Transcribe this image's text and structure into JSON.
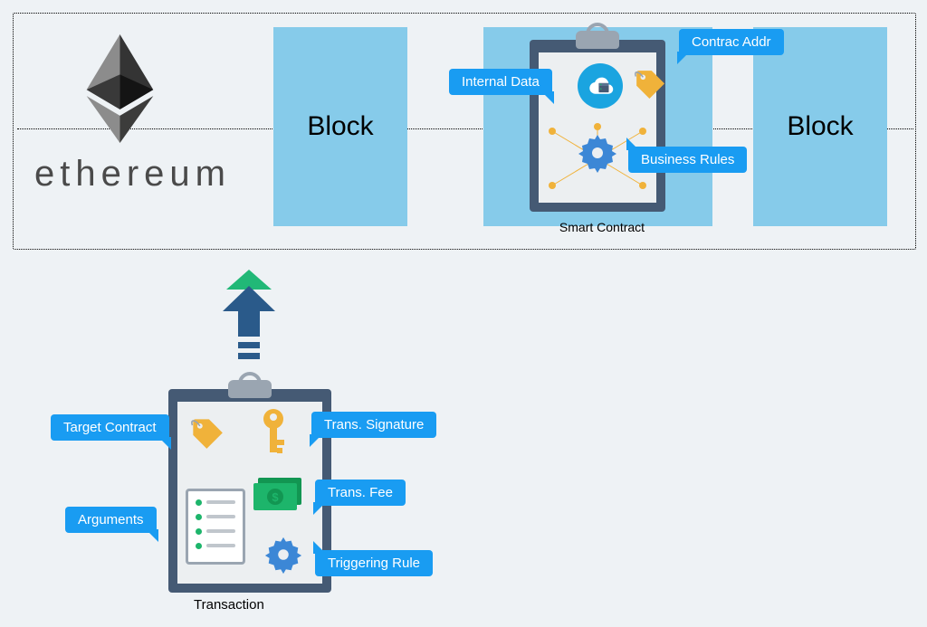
{
  "brand": "ethereum",
  "blocks": {
    "b1": "Block",
    "b3": "Block"
  },
  "smart_contract": {
    "label": "Smart Contract",
    "callouts": {
      "internal_data": "Internal Data",
      "contract_addr": "Contrac Addr",
      "business_rules": "Business Rules"
    }
  },
  "transaction": {
    "label": "Transaction",
    "callouts": {
      "target_contract": "Target Contract",
      "trans_signature": "Trans. Signature",
      "trans_fee": "Trans. Fee",
      "arguments": "Arguments",
      "triggering_rule": "Triggering Rule"
    }
  },
  "colors": {
    "callout": "#199cf2",
    "block": "#86cbea",
    "clipboard": "#455a74",
    "accent_yellow": "#f0b23a",
    "gear_blue": "#3c87d6",
    "money_green": "#1db56b",
    "arrow_blue": "#2a5a8a",
    "arrow_green": "#21b877"
  }
}
